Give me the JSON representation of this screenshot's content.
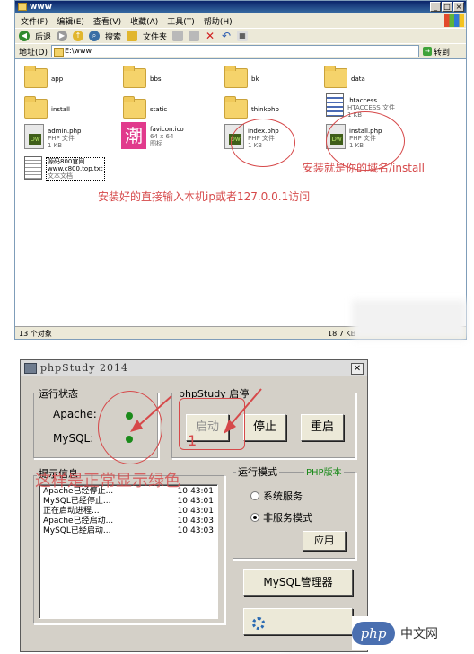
{
  "explorer": {
    "title": "www",
    "menu": [
      "文件(F)",
      "编辑(E)",
      "查看(V)",
      "收藏(A)",
      "工具(T)",
      "帮助(H)"
    ],
    "toolbar": {
      "back": "后退",
      "search": "搜索",
      "folders": "文件夹"
    },
    "address": {
      "label": "地址(D)",
      "value": "E:\\www",
      "go": "转到"
    },
    "files": [
      {
        "name": "app",
        "type": "folder"
      },
      {
        "name": "bbs",
        "type": "folder"
      },
      {
        "name": "bk",
        "type": "folder"
      },
      {
        "name": "data",
        "type": "folder"
      },
      {
        "name": "install",
        "type": "folder"
      },
      {
        "name": "static",
        "type": "folder"
      },
      {
        "name": "thinkphp",
        "type": "folder"
      },
      {
        "name": ".htaccess",
        "type": "htaccess",
        "meta1": "HTACCESS 文件",
        "meta2": "1 KB"
      },
      {
        "name": "admin.php",
        "type": "php",
        "meta1": "PHP 文件",
        "meta2": "1 KB"
      },
      {
        "name": "favicon.ico",
        "type": "ico",
        "meta1": "64 x 64",
        "meta2": "图标"
      },
      {
        "name": "index.php",
        "type": "php",
        "meta1": "PHP 文件",
        "meta2": "1 KB"
      },
      {
        "name": "install.php",
        "type": "php",
        "meta1": "PHP 文件",
        "meta2": "1 KB"
      },
      {
        "name": "源码800官网",
        "type": "txt",
        "meta1": "www.c800.top.txt",
        "meta2": "文本文档"
      }
    ],
    "icon_glyph": "潮",
    "annotations": {
      "install_note": "安装就是你的域名/install",
      "access_note": "安装好的直接输入本机ip或者127.0.0.1访问"
    },
    "status": {
      "objects": "13 个对象",
      "size": "18.7 KB"
    }
  },
  "phpstudy": {
    "title": "phpStudy 2014",
    "close": "✕",
    "run_status": {
      "label": "运行状态",
      "services": [
        {
          "name": "Apache:",
          "status_color": "#1a8a1a"
        },
        {
          "name": "MySQL:",
          "status_color": "#1a8a1a"
        }
      ]
    },
    "start_stop": {
      "label": "phpStudy 启停",
      "start": "启动",
      "stop": "停止",
      "restart": "重启"
    },
    "annotation_number": "1",
    "annotation_text": "这样是正常显示绿色",
    "log": {
      "label": "提示信息",
      "rows": [
        {
          "text": "Apache已经停止...",
          "time": "10:43:01"
        },
        {
          "text": "MySQL已经停止...",
          "time": "10:43:01"
        },
        {
          "text": "正在启动进程...",
          "time": "10:43:01"
        },
        {
          "text": "Apache已经启动...",
          "time": "10:43:03"
        },
        {
          "text": "MySQL已经启动...",
          "time": "10:43:03"
        }
      ]
    },
    "run_mode": {
      "label": "运行模式",
      "php_version_label": "PHP版本",
      "options": [
        {
          "label": "系统服务",
          "selected": false
        },
        {
          "label": "非服务模式",
          "selected": true
        }
      ],
      "apply": "应用"
    },
    "mysql_manager": "MySQL管理器"
  },
  "watermark": {
    "logo": "php",
    "text": "中文网"
  },
  "colors": {
    "annotation_red": "#d6494a",
    "status_green": "#1a8a1a",
    "watermark_blue": "#4a6fb0"
  }
}
